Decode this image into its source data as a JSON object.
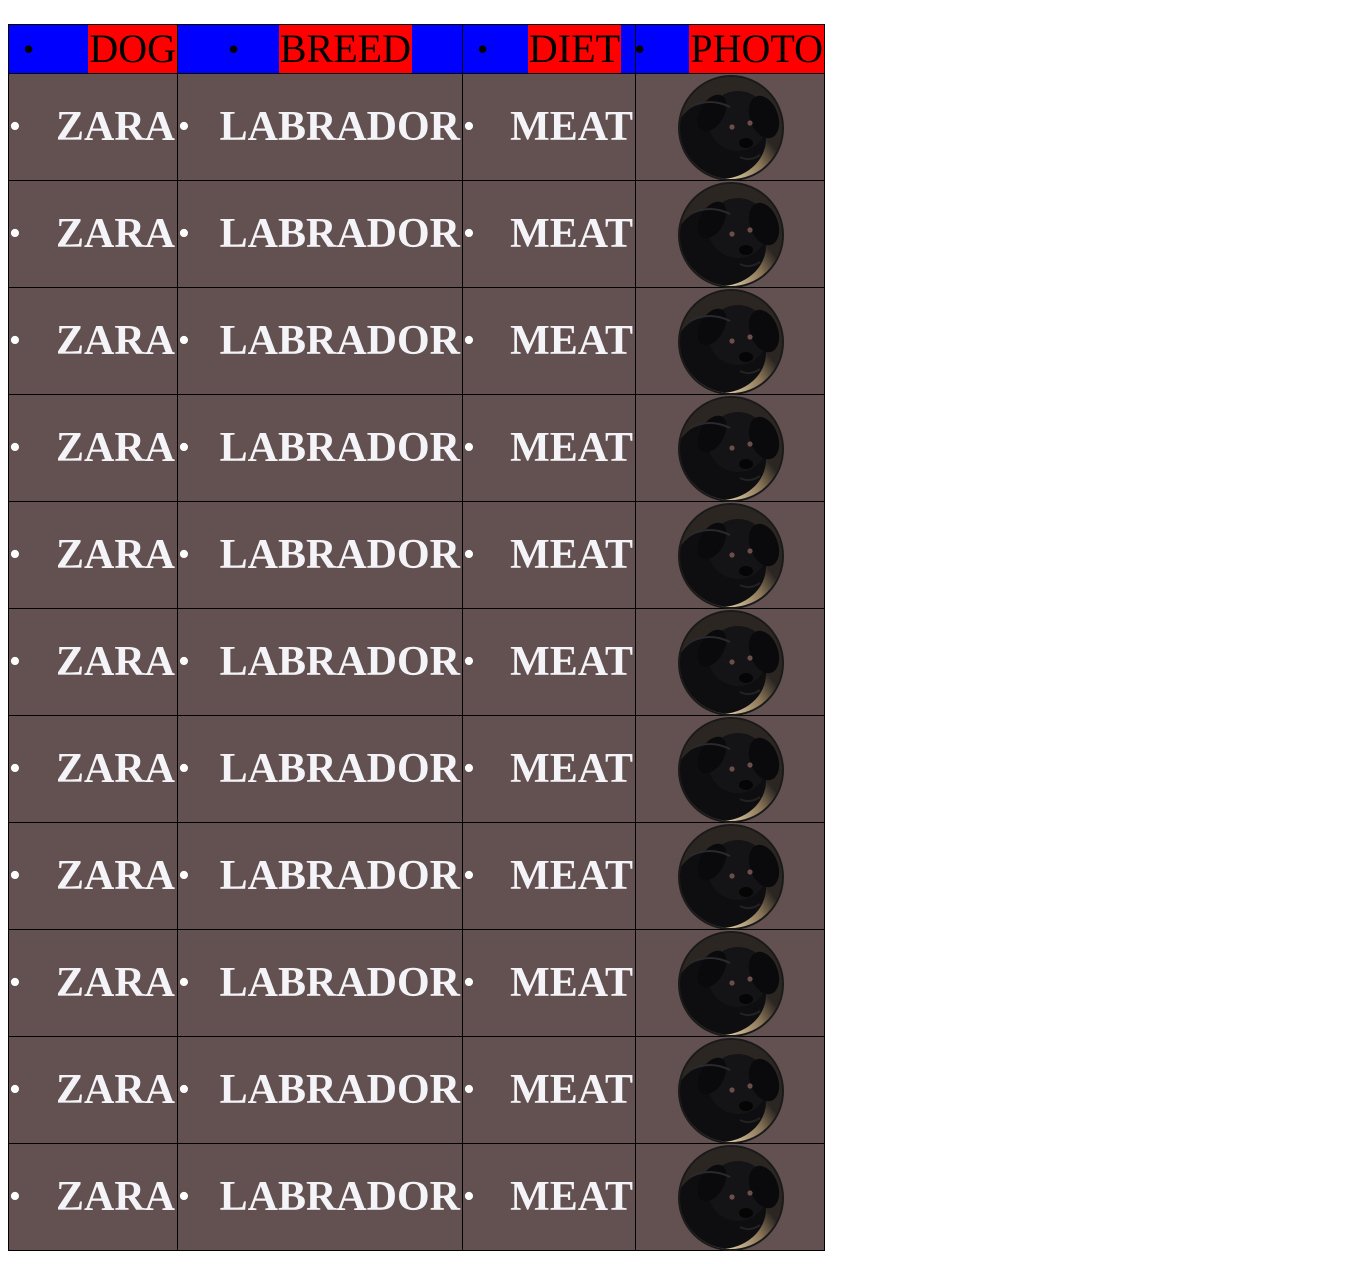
{
  "table": {
    "headers": [
      "DOG",
      "BREED",
      "DIET",
      "PHOTO"
    ],
    "rows": [
      {
        "dog": "ZARA",
        "breed": "LABRADOR",
        "diet": "MEAT",
        "photo": "black-labrador-puppy"
      },
      {
        "dog": "ZARA",
        "breed": "LABRADOR",
        "diet": "MEAT",
        "photo": "black-labrador-puppy"
      },
      {
        "dog": "ZARA",
        "breed": "LABRADOR",
        "diet": "MEAT",
        "photo": "black-labrador-puppy"
      },
      {
        "dog": "ZARA",
        "breed": "LABRADOR",
        "diet": "MEAT",
        "photo": "black-labrador-puppy"
      },
      {
        "dog": "ZARA",
        "breed": "LABRADOR",
        "diet": "MEAT",
        "photo": "black-labrador-puppy"
      },
      {
        "dog": "ZARA",
        "breed": "LABRADOR",
        "diet": "MEAT",
        "photo": "black-labrador-puppy"
      },
      {
        "dog": "ZARA",
        "breed": "LABRADOR",
        "diet": "MEAT",
        "photo": "black-labrador-puppy"
      },
      {
        "dog": "ZARA",
        "breed": "LABRADOR",
        "diet": "MEAT",
        "photo": "black-labrador-puppy"
      },
      {
        "dog": "ZARA",
        "breed": "LABRADOR",
        "diet": "MEAT",
        "photo": "black-labrador-puppy"
      },
      {
        "dog": "ZARA",
        "breed": "LABRADOR",
        "diet": "MEAT",
        "photo": "black-labrador-puppy"
      },
      {
        "dog": "ZARA",
        "breed": "LABRADOR",
        "diet": "MEAT",
        "photo": "black-labrador-puppy"
      }
    ]
  },
  "colors": {
    "header_bg": "#0000ff",
    "header_label_bg": "#ff0000",
    "body_bg": "#625150",
    "body_text": "#f4f4f8"
  }
}
